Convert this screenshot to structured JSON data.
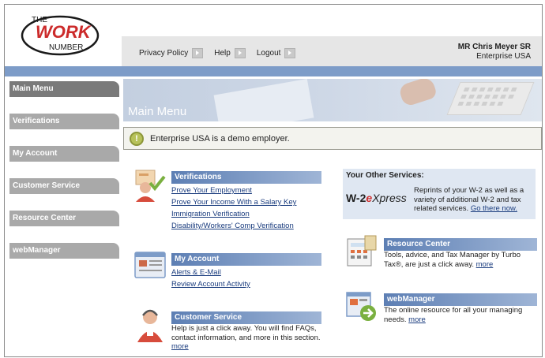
{
  "logo": {
    "the": "THE",
    "work": "WORK",
    "number": "NUMBER"
  },
  "header": {
    "links": {
      "privacy": "Privacy Policy",
      "help": "Help",
      "logout": "Logout"
    },
    "user_name": "MR Chris Meyer SR",
    "employer": "Enterprise USA"
  },
  "sidebar": {
    "items": [
      {
        "label": "Main Menu"
      },
      {
        "label": "Verifications"
      },
      {
        "label": "My Account"
      },
      {
        "label": "Customer Service"
      },
      {
        "label": "Resource Center"
      },
      {
        "label": "webManager"
      }
    ]
  },
  "banner": {
    "title": "Main Menu"
  },
  "notice": {
    "text": "Enterprise USA is a demo employer."
  },
  "verifications": {
    "title": "Verifications",
    "links": [
      "Prove Your Employment",
      "Prove Your Income With a Salary Key",
      "Immigration Verification",
      "Disability/Workers' Comp Verification"
    ]
  },
  "my_account": {
    "title": "My Account",
    "links": [
      "Alerts & E-Mail",
      "Review Account Activity"
    ]
  },
  "customer_service": {
    "title": "Customer Service",
    "desc": "Help is just a click away. You will find FAQs, contact information, and more in this section.",
    "more": "more"
  },
  "other_services": {
    "title": "Your Other Services:",
    "w2_prefix": "W-2",
    "w2_e": "e",
    "w2_xpress": "Xpress",
    "desc": "Reprints of your W-2 as well as a variety of additional W-2 and tax related services.",
    "link": "Go there now."
  },
  "resource_center": {
    "title": "Resource Center",
    "desc": "Tools, advice, and Tax Manager by Turbo Tax®, are just a click away.",
    "more": "more"
  },
  "webmanager": {
    "title": "webManager",
    "desc": "The online resource for all your managing needs.",
    "more": "more"
  },
  "colors": {
    "nav_gray": "#a9a9a9",
    "nav_active": "#7a7a7a",
    "accent_blue": "#7d9cc8",
    "logo_red": "#cc2b2b",
    "link_blue": "#1a3c7e"
  }
}
